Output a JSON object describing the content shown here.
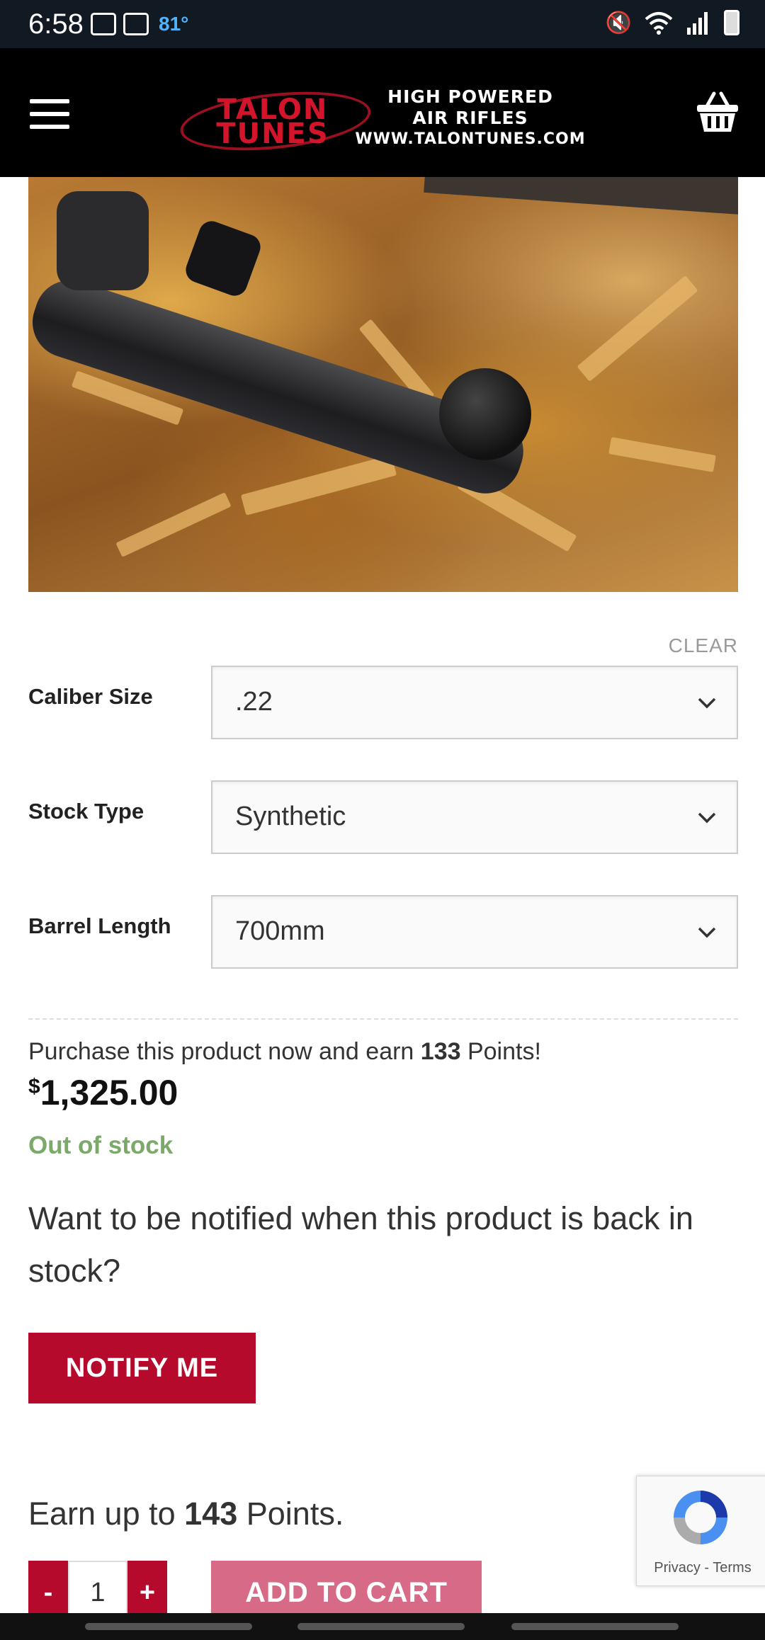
{
  "status_bar": {
    "time": "6:58",
    "temperature": "81°"
  },
  "header": {
    "logo_brand_line1": "TALON",
    "logo_brand_line2": "TUNES",
    "logo_tagline_1": "HIGH POWERED",
    "logo_tagline_2": "AIR RIFLES",
    "logo_url": "WWW.TALONTUNES.COM"
  },
  "variations": {
    "clear_label": "CLEAR",
    "rows": [
      {
        "label": "Caliber Size",
        "value": ".22"
      },
      {
        "label": "Stock Type",
        "value": "Synthetic"
      },
      {
        "label": "Barrel Length",
        "value": "700mm"
      }
    ]
  },
  "purchase": {
    "points_prefix": "Purchase this product now and earn ",
    "points_value": "133",
    "points_suffix": " Points!",
    "currency_symbol": "$",
    "price": "1,325.00",
    "stock_status": "Out of stock",
    "notify_question": "Want to be notified when this product is back in stock?",
    "notify_button": "NOTIFY ME"
  },
  "cart": {
    "earn_prefix": "Earn up to ",
    "earn_value": "143",
    "earn_suffix": " Points.",
    "minus_label": "-",
    "plus_label": "+",
    "quantity": "1",
    "add_to_cart_label": "ADD TO CART"
  },
  "recaptcha": {
    "privacy": "Privacy",
    "separator": " - ",
    "terms": "Terms"
  },
  "colors": {
    "brand_red": "#b60a2d",
    "add_to_cart_pink": "#d76a86",
    "stock_green": "#7aa968"
  },
  "icons": [
    "hamburger-menu-icon",
    "shopping-basket-icon",
    "chevron-down-icon",
    "recaptcha-icon"
  ]
}
